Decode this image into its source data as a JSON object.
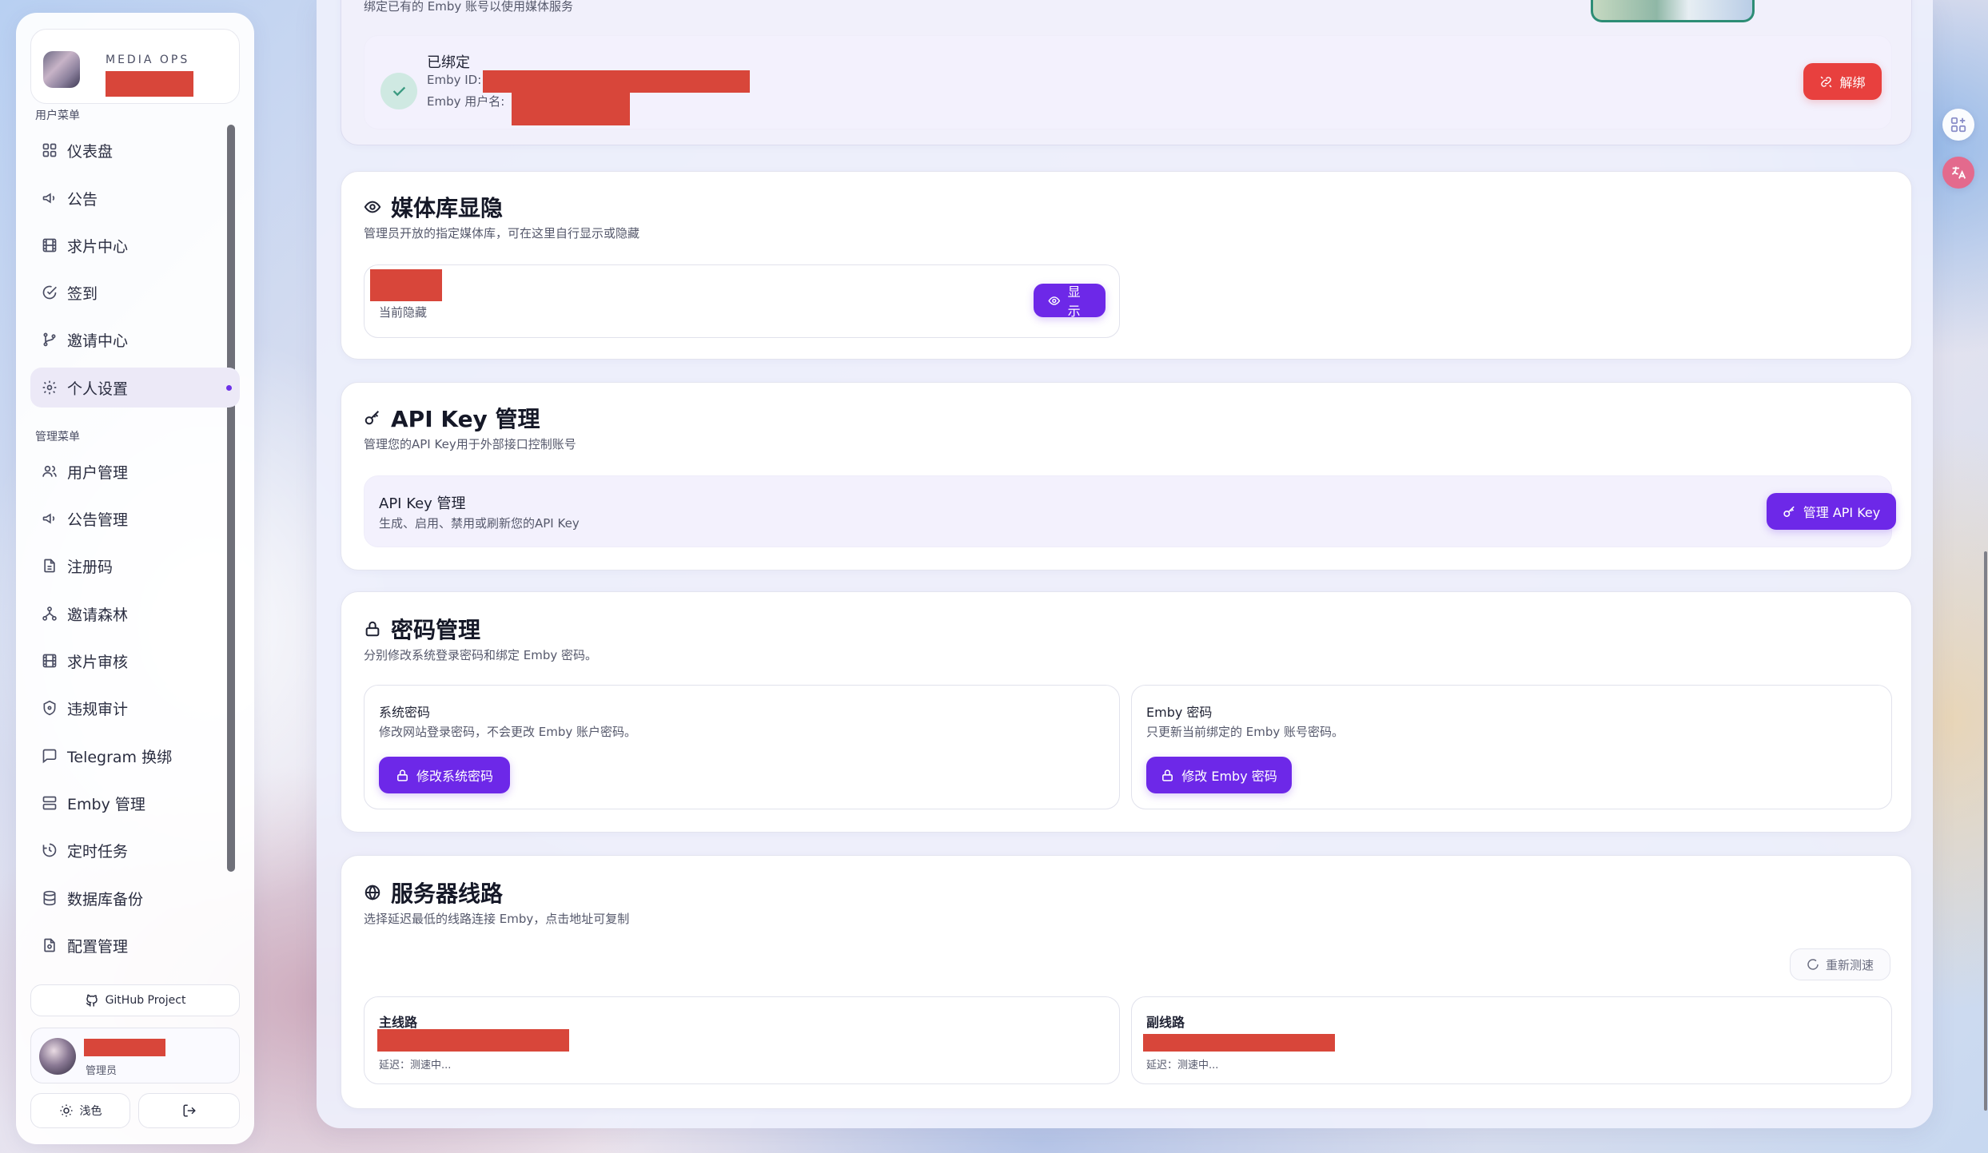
{
  "sidebar": {
    "brand_title": "MEDIA OPS",
    "user_section_label": "用户菜单",
    "admin_section_label": "管理菜单",
    "user_items": [
      {
        "label": "仪表盘",
        "icon": "dashboard-icon"
      },
      {
        "label": "公告",
        "icon": "megaphone-icon"
      },
      {
        "label": "求片中心",
        "icon": "film-icon"
      },
      {
        "label": "签到",
        "icon": "sign-in-icon"
      },
      {
        "label": "邀请中心",
        "icon": "branch-icon"
      },
      {
        "label": "个人设置",
        "icon": "gear-icon",
        "active": true
      }
    ],
    "admin_items": [
      {
        "label": "用户管理",
        "icon": "users-icon"
      },
      {
        "label": "公告管理",
        "icon": "megaphone-icon"
      },
      {
        "label": "注册码",
        "icon": "document-icon"
      },
      {
        "label": "邀请森林",
        "icon": "network-icon"
      },
      {
        "label": "求片审核",
        "icon": "film-icon"
      },
      {
        "label": "违规审计",
        "icon": "shield-icon"
      },
      {
        "label": "Telegram 换绑",
        "icon": "chat-icon"
      },
      {
        "label": "Emby 管理",
        "icon": "server-icon"
      },
      {
        "label": "定时任务",
        "icon": "clock-icon"
      },
      {
        "label": "数据库备份",
        "icon": "database-icon"
      },
      {
        "label": "配置管理",
        "icon": "config-file-icon"
      }
    ],
    "github_label": "GitHub Project",
    "user_role": "管理员",
    "theme_label": "浅色"
  },
  "emby_bind": {
    "subtitle": "绑定已有的 Emby 账号以使用媒体服务",
    "status": "已绑定",
    "id_label": "Emby ID:",
    "username_label": "Emby 用户名:",
    "unbind_label": "解绑"
  },
  "media_library": {
    "title": "媒体库显隐",
    "subtitle": "管理员开放的指定媒体库，可在这里自行显示或隐藏",
    "item_status": "当前隐藏",
    "show_label": "显示"
  },
  "api_key": {
    "title": "API Key 管理",
    "subtitle": "管理您的API Key用于外部接口控制账号",
    "row_title": "API Key 管理",
    "row_desc": "生成、启用、禁用或刷新您的API Key",
    "manage_label": "管理 API Key"
  },
  "password": {
    "title": "密码管理",
    "subtitle": "分别修改系统登录密码和绑定 Emby 密码。",
    "system": {
      "title": "系统密码",
      "desc": "修改网站登录密码，不会更改 Emby 账户密码。",
      "button": "修改系统密码"
    },
    "emby": {
      "title": "Emby 密码",
      "desc": "只更新当前绑定的 Emby 账号密码。",
      "button": "修改 Emby 密码"
    }
  },
  "server_routes": {
    "title": "服务器线路",
    "subtitle": "选择延迟最低的线路连接 Emby，点击地址可复制",
    "retest_label": "重新测速",
    "routes": [
      {
        "name": "主线路",
        "latency": "延迟：测速中..."
      },
      {
        "name": "副线路",
        "latency": "延迟：测速中..."
      }
    ]
  },
  "colors": {
    "accent": "#6d28e8",
    "danger": "#e8403e",
    "redaction": "#d8463a"
  }
}
